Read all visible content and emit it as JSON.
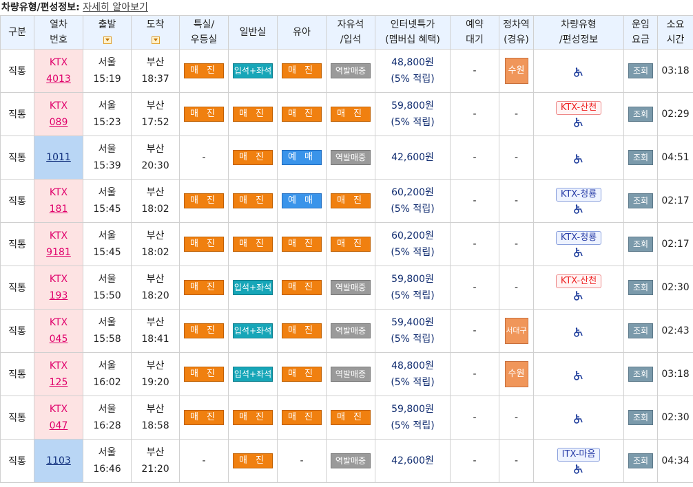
{
  "topbar": {
    "title": "차량유형/편성정보:",
    "link": "자세히 알아보기"
  },
  "headers": {
    "gubun": "구분",
    "train_no_1": "열차",
    "train_no_2": "번호",
    "dep": "출발",
    "arr": "도착",
    "special_1": "특실/",
    "special_2": "우등실",
    "general": "일반실",
    "infant": "유아",
    "free_1": "자유석",
    "free_2": "/입석",
    "internet_1": "인터넷특가",
    "internet_2": "(멤버십 혜택)",
    "wait_1": "예약",
    "wait_2": "대기",
    "stop_1": "정차역",
    "stop_2": "(경유)",
    "vehicle_1": "차량유형",
    "vehicle_2": "/편성정보",
    "fare_1": "운임",
    "fare_2": "요금",
    "duration_1": "소요",
    "duration_2": "시간"
  },
  "rows": [
    {
      "gubun": "직통",
      "type": "KTX",
      "num": "4013",
      "dep_st": "서울",
      "dep_t": "15:19",
      "arr_st": "부산",
      "arr_t": "18:37",
      "special": "매 진",
      "general": "입석+좌석",
      "infant": "매 진",
      "free": "역발매중",
      "price": "48,800원",
      "point": "(5% 적립)",
      "wait": "-",
      "stop": "수원",
      "vehicle": "",
      "lookup": "조회",
      "dur": "03:18"
    },
    {
      "gubun": "직통",
      "type": "KTX",
      "num": "089",
      "dep_st": "서울",
      "dep_t": "15:23",
      "arr_st": "부산",
      "arr_t": "17:52",
      "special": "매 진",
      "general": "매 진",
      "infant": "매 진",
      "free": "매 진",
      "price": "59,800원",
      "point": "(5% 적립)",
      "wait": "-",
      "stop": "-",
      "vehicle": "KTX-산천",
      "lookup": "조회",
      "dur": "02:29"
    },
    {
      "gubun": "직통",
      "type": "",
      "num": "1011",
      "dep_st": "서울",
      "dep_t": "15:39",
      "arr_st": "부산",
      "arr_t": "20:30",
      "special": "-",
      "general": "매 진",
      "infant": "예 매",
      "free": "역발매중",
      "price": "42,600원",
      "point": "",
      "wait": "-",
      "stop": "-",
      "vehicle": "",
      "lookup": "조회",
      "dur": "04:51"
    },
    {
      "gubun": "직통",
      "type": "KTX",
      "num": "181",
      "dep_st": "서울",
      "dep_t": "15:45",
      "arr_st": "부산",
      "arr_t": "18:02",
      "special": "매 진",
      "general": "매 진",
      "infant": "예 매",
      "free": "매 진",
      "price": "60,200원",
      "point": "(5% 적립)",
      "wait": "-",
      "stop": "-",
      "vehicle": "KTX-청룡",
      "lookup": "조회",
      "dur": "02:17"
    },
    {
      "gubun": "직통",
      "type": "KTX",
      "num": "9181",
      "dep_st": "서울",
      "dep_t": "15:45",
      "arr_st": "부산",
      "arr_t": "18:02",
      "special": "매 진",
      "general": "매 진",
      "infant": "매 진",
      "free": "매 진",
      "price": "60,200원",
      "point": "(5% 적립)",
      "wait": "-",
      "stop": "-",
      "vehicle": "KTX-청룡",
      "lookup": "조회",
      "dur": "02:17"
    },
    {
      "gubun": "직통",
      "type": "KTX",
      "num": "193",
      "dep_st": "서울",
      "dep_t": "15:50",
      "arr_st": "부산",
      "arr_t": "18:20",
      "special": "매 진",
      "general": "입석+좌석",
      "infant": "매 진",
      "free": "역발매중",
      "price": "59,800원",
      "point": "(5% 적립)",
      "wait": "-",
      "stop": "-",
      "vehicle": "KTX-산천",
      "lookup": "조회",
      "dur": "02:30"
    },
    {
      "gubun": "직통",
      "type": "KTX",
      "num": "045",
      "dep_st": "서울",
      "dep_t": "15:58",
      "arr_st": "부산",
      "arr_t": "18:41",
      "special": "매 진",
      "general": "입석+좌석",
      "infant": "매 진",
      "free": "역발매중",
      "price": "59,400원",
      "point": "(5% 적립)",
      "wait": "-",
      "stop": "서대구",
      "vehicle": "",
      "lookup": "조회",
      "dur": "02:43"
    },
    {
      "gubun": "직통",
      "type": "KTX",
      "num": "125",
      "dep_st": "서울",
      "dep_t": "16:02",
      "arr_st": "부산",
      "arr_t": "19:20",
      "special": "매 진",
      "general": "입석+좌석",
      "infant": "매 진",
      "free": "역발매중",
      "price": "48,800원",
      "point": "(5% 적립)",
      "wait": "-",
      "stop": "수원",
      "vehicle": "",
      "lookup": "조회",
      "dur": "03:18"
    },
    {
      "gubun": "직통",
      "type": "KTX",
      "num": "047",
      "dep_st": "서울",
      "dep_t": "16:28",
      "arr_st": "부산",
      "arr_t": "18:58",
      "special": "매 진",
      "general": "매 진",
      "infant": "매 진",
      "free": "매 진",
      "price": "59,800원",
      "point": "(5% 적립)",
      "wait": "-",
      "stop": "-",
      "vehicle": "",
      "lookup": "조회",
      "dur": "02:30"
    },
    {
      "gubun": "직통",
      "type": "",
      "num": "1103",
      "dep_st": "서울",
      "dep_t": "16:46",
      "arr_st": "부산",
      "arr_t": "21:20",
      "special": "-",
      "general": "매 진",
      "infant": "-",
      "free": "역발매중",
      "price": "42,600원",
      "point": "",
      "wait": "-",
      "stop": "-",
      "vehicle": "ITX-마음",
      "lookup": "조회",
      "dur": "04:34"
    }
  ]
}
